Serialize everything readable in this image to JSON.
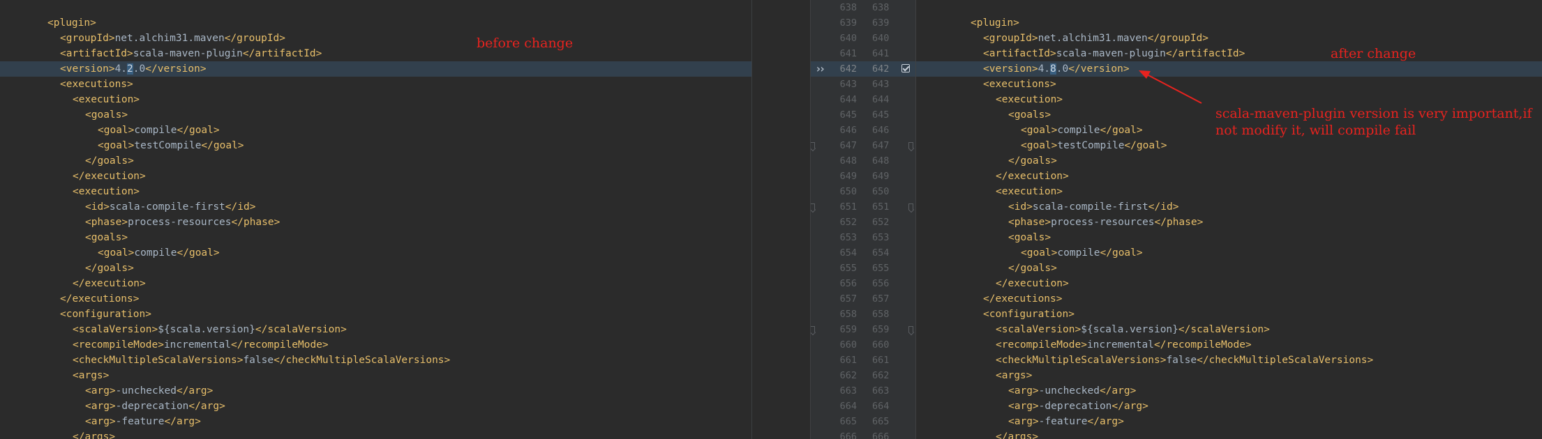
{
  "left_start_line": 638,
  "right_start_line": 638,
  "highlight_line": 642,
  "left_lines": [
    [],
    [
      {
        "t": "<plugin>",
        "k": "tag"
      }
    ],
    [
      {
        "t": "<groupId>",
        "k": "tag"
      },
      {
        "t": "net.alchim31.maven",
        "k": "txt"
      },
      {
        "t": "</groupId>",
        "k": "tag"
      }
    ],
    [
      {
        "t": "<artifactId>",
        "k": "tag"
      },
      {
        "t": "scala-maven-plugin",
        "k": "txt"
      },
      {
        "t": "</artifactId>",
        "k": "tag"
      }
    ],
    [
      {
        "t": "<version>",
        "k": "tag"
      },
      {
        "t": "4.",
        "k": "txt"
      },
      {
        "t": "2",
        "k": "diff"
      },
      {
        "t": ".0",
        "k": "txt"
      },
      {
        "t": "</version>",
        "k": "tag"
      }
    ],
    [
      {
        "t": "<executions>",
        "k": "tag"
      }
    ],
    [
      {
        "t": "<execution>",
        "k": "tag"
      }
    ],
    [
      {
        "t": "<goals>",
        "k": "tag"
      }
    ],
    [
      {
        "t": "<goal>",
        "k": "tag"
      },
      {
        "t": "compile",
        "k": "txt"
      },
      {
        "t": "</goal>",
        "k": "tag"
      }
    ],
    [
      {
        "t": "<goal>",
        "k": "tag"
      },
      {
        "t": "testCompile",
        "k": "txt"
      },
      {
        "t": "</goal>",
        "k": "tag"
      }
    ],
    [
      {
        "t": "</goals>",
        "k": "tag"
      }
    ],
    [
      {
        "t": "</execution>",
        "k": "tag"
      }
    ],
    [
      {
        "t": "<execution>",
        "k": "tag"
      }
    ],
    [
      {
        "t": "<id>",
        "k": "tag"
      },
      {
        "t": "scala-compile-first",
        "k": "txt"
      },
      {
        "t": "</id>",
        "k": "tag"
      }
    ],
    [
      {
        "t": "<phase>",
        "k": "tag"
      },
      {
        "t": "process-resources",
        "k": "txt"
      },
      {
        "t": "</phase>",
        "k": "tag"
      }
    ],
    [
      {
        "t": "<goals>",
        "k": "tag"
      }
    ],
    [
      {
        "t": "<goal>",
        "k": "tag"
      },
      {
        "t": "compile",
        "k": "txt"
      },
      {
        "t": "</goal>",
        "k": "tag"
      }
    ],
    [
      {
        "t": "</goals>",
        "k": "tag"
      }
    ],
    [
      {
        "t": "</execution>",
        "k": "tag"
      }
    ],
    [
      {
        "t": "</executions>",
        "k": "tag"
      }
    ],
    [
      {
        "t": "<configuration>",
        "k": "tag"
      }
    ],
    [
      {
        "t": "<scalaVersion>",
        "k": "tag"
      },
      {
        "t": "${scala.version}",
        "k": "txt"
      },
      {
        "t": "</scalaVersion>",
        "k": "tag"
      }
    ],
    [
      {
        "t": "<recompileMode>",
        "k": "tag"
      },
      {
        "t": "incremental",
        "k": "txt"
      },
      {
        "t": "</recompileMode>",
        "k": "tag"
      }
    ],
    [
      {
        "t": "<checkMultipleScalaVersions>",
        "k": "tag"
      },
      {
        "t": "false",
        "k": "txt"
      },
      {
        "t": "</checkMultipleScalaVersions>",
        "k": "tag"
      }
    ],
    [
      {
        "t": "<args>",
        "k": "tag"
      }
    ],
    [
      {
        "t": "<arg>",
        "k": "tag"
      },
      {
        "t": "-unchecked",
        "k": "txt"
      },
      {
        "t": "</arg>",
        "k": "tag"
      }
    ],
    [
      {
        "t": "<arg>",
        "k": "tag"
      },
      {
        "t": "-deprecation",
        "k": "txt"
      },
      {
        "t": "</arg>",
        "k": "tag"
      }
    ],
    [
      {
        "t": "<arg>",
        "k": "tag"
      },
      {
        "t": "-feature",
        "k": "txt"
      },
      {
        "t": "</arg>",
        "k": "tag"
      }
    ],
    [
      {
        "t": "</args>",
        "k": "tag"
      }
    ]
  ],
  "right_lines": [
    [],
    [
      {
        "t": "<plugin>",
        "k": "tag"
      }
    ],
    [
      {
        "t": "<groupId>",
        "k": "tag"
      },
      {
        "t": "net.alchim31.maven",
        "k": "txt"
      },
      {
        "t": "</groupId>",
        "k": "tag"
      }
    ],
    [
      {
        "t": "<artifactId>",
        "k": "tag"
      },
      {
        "t": "scala-maven-plugin",
        "k": "txt"
      },
      {
        "t": "</artifactId>",
        "k": "tag"
      }
    ],
    [
      {
        "t": "<version>",
        "k": "tag"
      },
      {
        "t": "4.",
        "k": "txt"
      },
      {
        "t": "8",
        "k": "diff"
      },
      {
        "t": ".0",
        "k": "txt"
      },
      {
        "t": "</version>",
        "k": "tag"
      }
    ],
    [
      {
        "t": "<executions>",
        "k": "tag"
      }
    ],
    [
      {
        "t": "<execution>",
        "k": "tag"
      }
    ],
    [
      {
        "t": "<goals>",
        "k": "tag"
      }
    ],
    [
      {
        "t": "<goal>",
        "k": "tag"
      },
      {
        "t": "compile",
        "k": "txt"
      },
      {
        "t": "</goal>",
        "k": "tag"
      }
    ],
    [
      {
        "t": "<goal>",
        "k": "tag"
      },
      {
        "t": "testCompile",
        "k": "txt"
      },
      {
        "t": "</goal>",
        "k": "tag"
      }
    ],
    [
      {
        "t": "</goals>",
        "k": "tag"
      }
    ],
    [
      {
        "t": "</execution>",
        "k": "tag"
      }
    ],
    [
      {
        "t": "<execution>",
        "k": "tag"
      }
    ],
    [
      {
        "t": "<id>",
        "k": "tag"
      },
      {
        "t": "scala-compile-first",
        "k": "txt"
      },
      {
        "t": "</id>",
        "k": "tag"
      }
    ],
    [
      {
        "t": "<phase>",
        "k": "tag"
      },
      {
        "t": "process-resources",
        "k": "txt"
      },
      {
        "t": "</phase>",
        "k": "tag"
      }
    ],
    [
      {
        "t": "<goals>",
        "k": "tag"
      }
    ],
    [
      {
        "t": "<goal>",
        "k": "tag"
      },
      {
        "t": "compile",
        "k": "txt"
      },
      {
        "t": "</goal>",
        "k": "tag"
      }
    ],
    [
      {
        "t": "</goals>",
        "k": "tag"
      }
    ],
    [
      {
        "t": "</execution>",
        "k": "tag"
      }
    ],
    [
      {
        "t": "</executions>",
        "k": "tag"
      }
    ],
    [
      {
        "t": "<configuration>",
        "k": "tag"
      }
    ],
    [
      {
        "t": "<scalaVersion>",
        "k": "tag"
      },
      {
        "t": "${scala.version}",
        "k": "txt"
      },
      {
        "t": "</scalaVersion>",
        "k": "tag"
      }
    ],
    [
      {
        "t": "<recompileMode>",
        "k": "tag"
      },
      {
        "t": "incremental",
        "k": "txt"
      },
      {
        "t": "</recompileMode>",
        "k": "tag"
      }
    ],
    [
      {
        "t": "<checkMultipleScalaVersions>",
        "k": "tag"
      },
      {
        "t": "false",
        "k": "txt"
      },
      {
        "t": "</checkMultipleScalaVersions>",
        "k": "tag"
      }
    ],
    [
      {
        "t": "<args>",
        "k": "tag"
      }
    ],
    [
      {
        "t": "<arg>",
        "k": "tag"
      },
      {
        "t": "-unchecked",
        "k": "txt"
      },
      {
        "t": "</arg>",
        "k": "tag"
      }
    ],
    [
      {
        "t": "<arg>",
        "k": "tag"
      },
      {
        "t": "-deprecation",
        "k": "txt"
      },
      {
        "t": "</arg>",
        "k": "tag"
      }
    ],
    [
      {
        "t": "<arg>",
        "k": "tag"
      },
      {
        "t": "-feature",
        "k": "txt"
      },
      {
        "t": "</arg>",
        "k": "tag"
      }
    ],
    [
      {
        "t": "</args>",
        "k": "tag"
      }
    ]
  ],
  "annotations": {
    "before": "before change",
    "after": "after change",
    "note": "scala-maven-plugin version is very important,if not modify it, will compile fail"
  },
  "colors": {
    "background": "#2b2b2b",
    "tag": "#e8bf6a",
    "text": "#a9b7c6",
    "annotation": "#e8231f",
    "changed_line": "#32404d",
    "changed_char": "#395f80"
  },
  "icons": {
    "apply_change": "double-chevron-right-icon",
    "accept_change": "checkbox-checked-icon",
    "fold_marker": "fold-marker-icon"
  }
}
